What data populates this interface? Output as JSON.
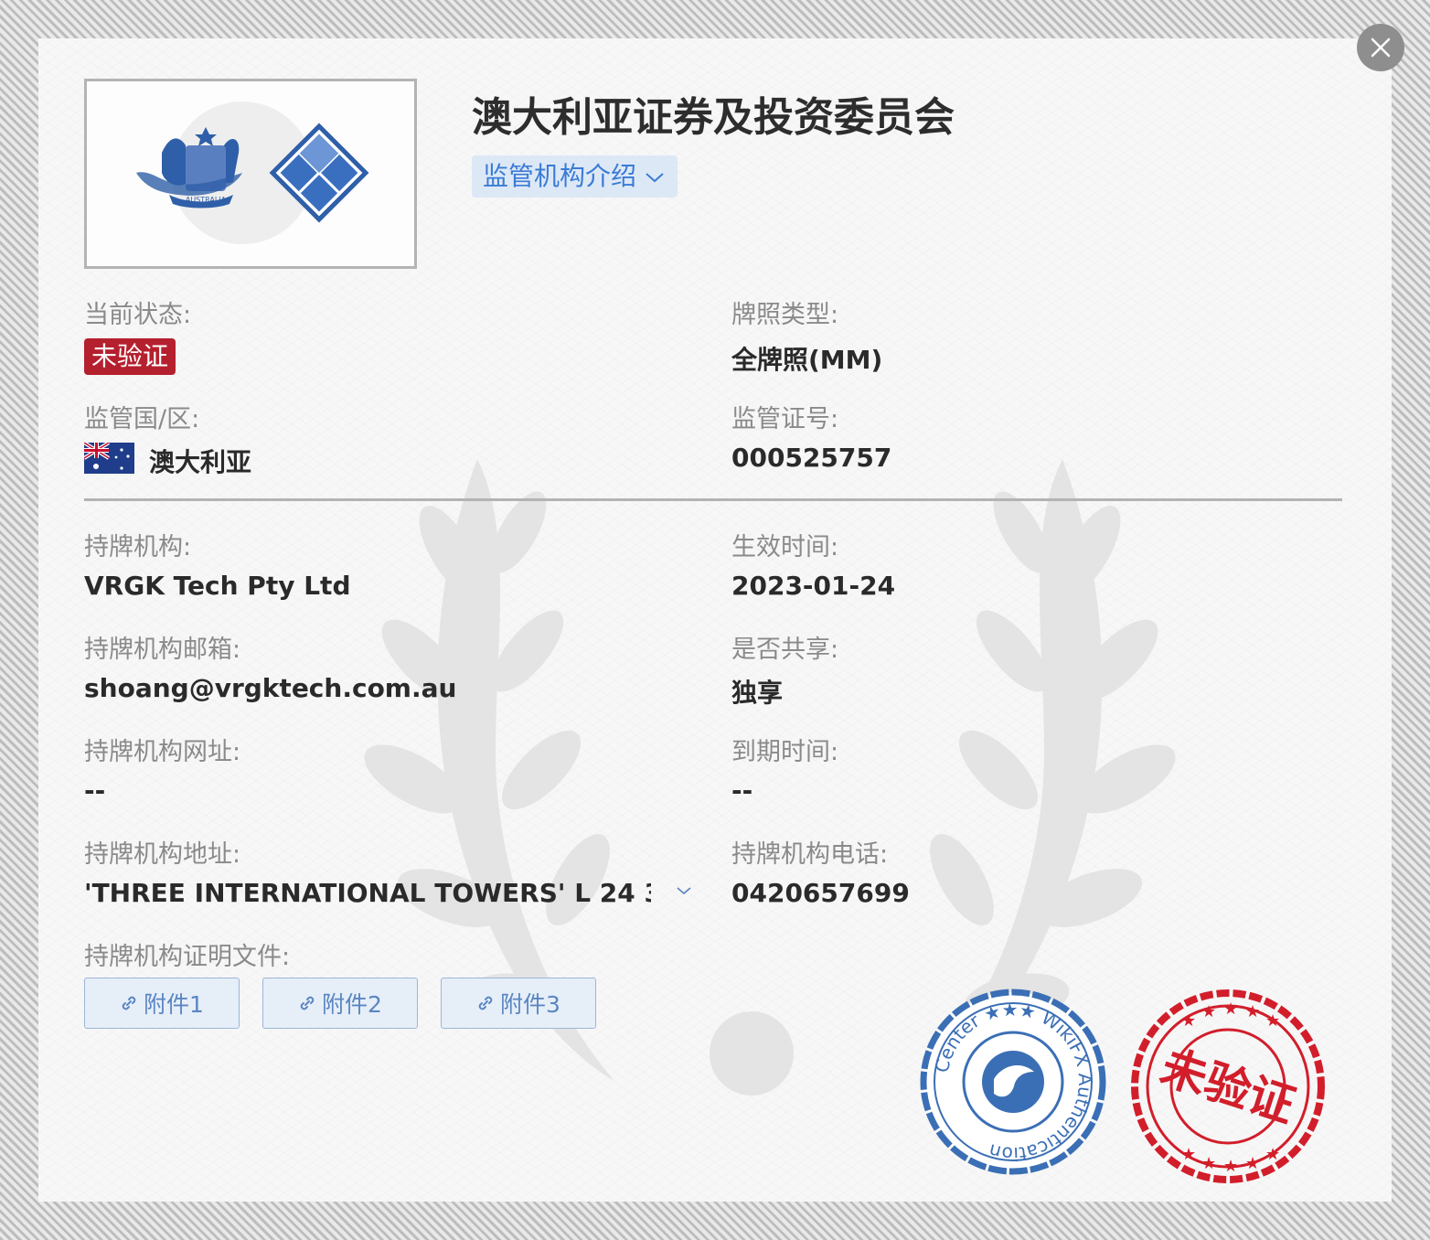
{
  "header": {
    "title": "澳大利亚证券及投资委员会",
    "intro_label": "监管机构介绍"
  },
  "logo": {
    "seal_text": "AUSTRALIA"
  },
  "status": {
    "label": "当前状态:",
    "value": "未验证"
  },
  "license_type": {
    "label": "牌照类型:",
    "value": "全牌照(MM)"
  },
  "region": {
    "label": "监管国/区:",
    "value": "澳大利亚"
  },
  "license_no": {
    "label": "监管证号:",
    "value": "000525757"
  },
  "holder": {
    "label": "持牌机构:",
    "value": "VRGK Tech Pty Ltd"
  },
  "effective": {
    "label": "生效时间:",
    "value": "2023-01-24"
  },
  "email": {
    "label": "持牌机构邮箱:",
    "value": "shoang@vrgktech.com.au"
  },
  "shared": {
    "label": "是否共享:",
    "value": "独享"
  },
  "website": {
    "label": "持牌机构网址:",
    "value": "--"
  },
  "expiry": {
    "label": "到期时间:",
    "value": "--"
  },
  "address": {
    "label": "持牌机构地址:",
    "value": "'THREE INTERNATIONAL TOWERS' L 24 3..."
  },
  "phone": {
    "label": "持牌机构电话:",
    "value": "0420657699"
  },
  "documents": {
    "label": "持牌机构证明文件:",
    "items": [
      "附件1",
      "附件2",
      "附件3"
    ]
  },
  "stamps": {
    "wikifx_text": "Center ★★★ WikiFX Authentication",
    "unverified_text": "未验证"
  },
  "colors": {
    "accent": "#3a7bd5",
    "status_red": "#b5202e",
    "stamp_blue": "#3b6fb5",
    "stamp_red": "#d21e2b"
  }
}
